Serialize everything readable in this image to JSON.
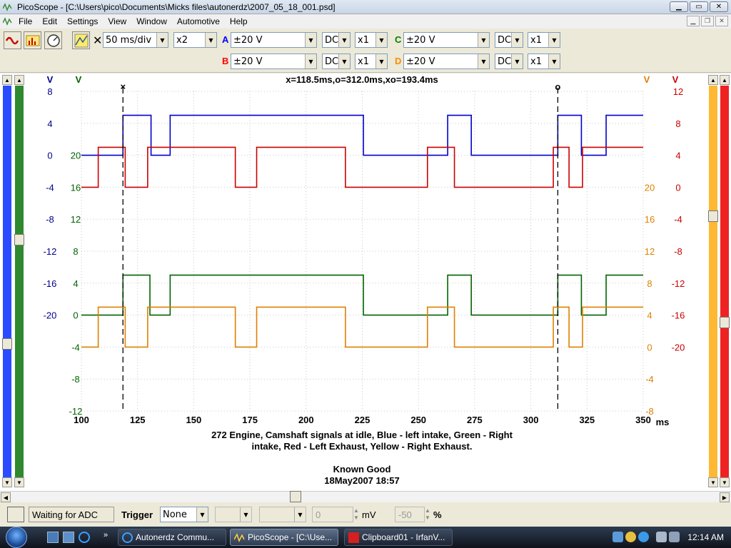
{
  "window": {
    "title": "PicoScope - [C:\\Users\\pico\\Documents\\Micks files\\autonerdz\\2007_05_18_001.psd]"
  },
  "menu": [
    "File",
    "Edit",
    "Settings",
    "View",
    "Window",
    "Automotive",
    "Help"
  ],
  "toolbar": {
    "timebase": "50 ms/div",
    "zoom": "x2",
    "channels": [
      {
        "label": "A",
        "range": "±20 V",
        "coupling": "DC",
        "probe": "x1",
        "color": "#0000ff"
      },
      {
        "label": "B",
        "range": "±20 V",
        "coupling": "DC",
        "probe": "x1",
        "color": "#ff0000"
      },
      {
        "label": "C",
        "range": "±20 V",
        "coupling": "DC",
        "probe": "x1",
        "color": "#008000"
      },
      {
        "label": "D",
        "range": "±20 V",
        "coupling": "DC",
        "probe": "x1",
        "color": "#ff8c00"
      }
    ]
  },
  "scope": {
    "readout": "x=118.5ms,o=312.0ms,xo=193.4ms",
    "cursor_x_label": "×",
    "cursor_o_label": "o",
    "x_unit": "ms",
    "x_ticks": [
      "100",
      "125",
      "150",
      "175",
      "200",
      "225",
      "250",
      "275",
      "300",
      "325",
      "350"
    ],
    "axis_A": {
      "unit": "V",
      "color": "#00008b",
      "ticks": [
        "8",
        "4",
        "0",
        "-4",
        "-8",
        "-12",
        "-16",
        "-20"
      ]
    },
    "axis_C": {
      "unit": "V",
      "color": "#006400",
      "ticks": [
        "20",
        "16",
        "12",
        "8",
        "4",
        "0",
        "-4",
        "-8",
        "-12"
      ]
    },
    "axis_D": {
      "unit": "V",
      "color": "#e08000",
      "ticks": [
        "20",
        "16",
        "12",
        "8",
        "4",
        "0",
        "-4",
        "-8"
      ]
    },
    "axis_B": {
      "unit": "V",
      "color": "#cc0000",
      "ticks": [
        "12",
        "8",
        "4",
        "0",
        "-4",
        "-8",
        "-12",
        "-16",
        "-20"
      ]
    },
    "caption_line1": "272 Engine, Camshaft signals at idle, Blue - left intake, Green - Right",
    "caption_line2": "intake, Red - Left Exhaust, Yellow - Right Exhaust.",
    "note": "Known Good",
    "date": "18May2007  18:57"
  },
  "chart_data": {
    "type": "line",
    "x_range": [
      100,
      350
    ],
    "x_unit": "ms",
    "cursors": {
      "x": 118.5,
      "o": 312.0
    },
    "series": [
      {
        "channel": "A",
        "color": "#0000cc",
        "low_v": 0,
        "high_v": 5,
        "high_intervals": [
          [
            118.5,
            131
          ],
          [
            139.5,
            225.5
          ],
          [
            263,
            273.5
          ],
          [
            312,
            322.5
          ],
          [
            333.5,
            350
          ]
        ]
      },
      {
        "channel": "B",
        "color": "#cc0000",
        "low_v": 0,
        "high_v": 5,
        "high_intervals": [
          [
            107.5,
            119.5
          ],
          [
            129.5,
            168.5
          ],
          [
            178,
            217.5
          ],
          [
            254,
            266
          ],
          [
            310,
            317
          ],
          [
            323,
            350
          ]
        ]
      },
      {
        "channel": "C",
        "color": "#006400",
        "low_v": 0,
        "high_v": 5,
        "high_intervals": [
          [
            118.5,
            130.5
          ],
          [
            139.5,
            225.5
          ],
          [
            263,
            273.5
          ],
          [
            312,
            322.5
          ],
          [
            333.5,
            350
          ]
        ]
      },
      {
        "channel": "D",
        "color": "#e08000",
        "low_v": 0,
        "high_v": 5,
        "high_intervals": [
          [
            107.5,
            119.5
          ],
          [
            129.5,
            168.5
          ],
          [
            178,
            217.5
          ],
          [
            254,
            266
          ],
          [
            310,
            317
          ],
          [
            323,
            350
          ]
        ]
      }
    ]
  },
  "status": {
    "message": "Waiting for ADC",
    "trigger_label": "Trigger",
    "trigger_mode": "None",
    "level": "0",
    "level_unit": "mV",
    "pretrigger": "-50",
    "pretrigger_unit": "%"
  },
  "taskbar": {
    "items": [
      "Autonerdz Commu...",
      "PicoScope - [C:\\Use...",
      "Clipboard01 - IrfanV..."
    ],
    "clock": "12:14 AM"
  }
}
